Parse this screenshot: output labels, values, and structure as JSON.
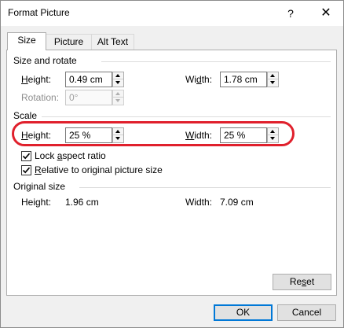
{
  "window": {
    "title": "Format Picture",
    "help_label": "?",
    "close_label": "✕"
  },
  "tabs": [
    {
      "label": "Size",
      "active": true
    },
    {
      "label": "Picture",
      "active": false
    },
    {
      "label": "Alt Text",
      "active": false
    }
  ],
  "size_and_rotate": {
    "heading": "Size and rotate",
    "height_label": "Height:",
    "height_value": "0.49 cm",
    "width_label": "Width:",
    "width_value": "1.78 cm",
    "rotation_label": "Rotation:",
    "rotation_value": "0°"
  },
  "scale": {
    "heading": "Scale",
    "height_label": "Height:",
    "height_value": "25 %",
    "width_label": "Width:",
    "width_value": "25 %",
    "lock_aspect_label": "Lock aspect ratio",
    "lock_aspect_checked": true,
    "relative_label": "Relative to original picture size",
    "relative_checked": true
  },
  "original_size": {
    "heading": "Original size",
    "height_label": "Height:",
    "height_value": "1.96 cm",
    "width_label": "Width:",
    "width_value": "7.09 cm"
  },
  "buttons": {
    "reset": "Reset",
    "ok": "OK",
    "cancel": "Cancel"
  },
  "colors": {
    "annotation": "#e0202c",
    "default_button": "#0078d7"
  }
}
